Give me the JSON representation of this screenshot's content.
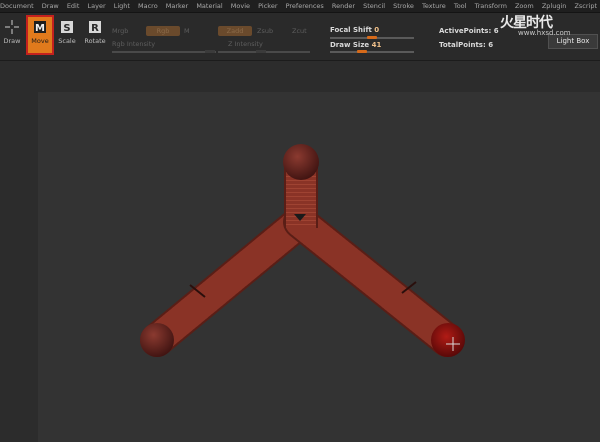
{
  "menu": [
    "Document",
    "Draw",
    "Edit",
    "Layer",
    "Light",
    "Macro",
    "Marker",
    "Material",
    "Movie",
    "Picker",
    "Preferences",
    "Render",
    "Stencil",
    "Stroke",
    "Texture",
    "Tool",
    "Transform",
    "Zoom",
    "Zplugin",
    "Zscript"
  ],
  "tools": {
    "draw": "Draw",
    "move": "Move",
    "scale": "Scale",
    "rotate": "Rotate"
  },
  "brush": {
    "mrgb": "Mrgb",
    "rgb": "Rgb",
    "m": "M",
    "rgb_intensity": "Rgb Intensity",
    "zadd": "Zadd",
    "zsub": "Zsub",
    "zcut": "Zcut",
    "z_intensity": "Z Intensity"
  },
  "focal_shift": {
    "label": "Focal Shift",
    "value": "0",
    "level": 0.5
  },
  "draw_size": {
    "label": "Draw Size",
    "value": "41",
    "level": 0.38
  },
  "stats": {
    "active_points": "ActivePoints: 6",
    "total_points": "TotalPoints: 6"
  },
  "lightbox": "Light Box",
  "watermark": {
    "text": "火星时代",
    "url": "www.hxsd.com"
  },
  "colors": {
    "accent": "#e07a1c",
    "highlight": "#c4211e",
    "model": "#8a3326"
  }
}
